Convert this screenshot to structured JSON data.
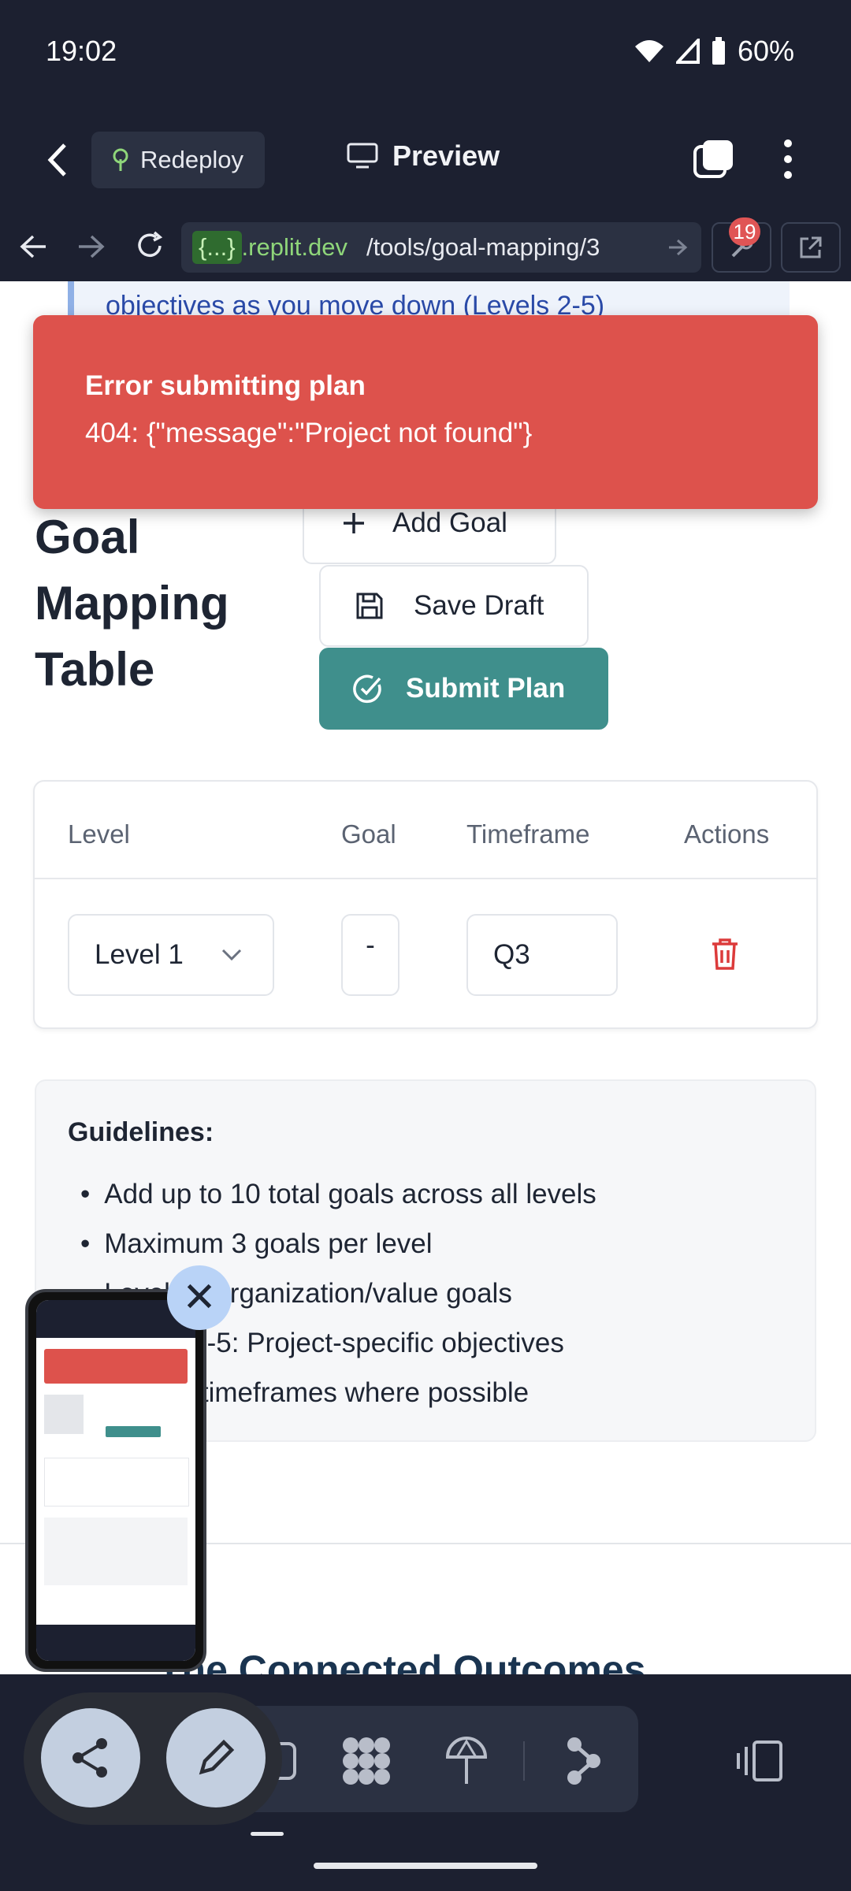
{
  "status_bar": {
    "time": "19:02",
    "battery": "60%"
  },
  "app_bar": {
    "redeploy_label": "Redeploy",
    "preview_label": "Preview"
  },
  "url_bar": {
    "brace": "{...}",
    "domain": ".replit.dev",
    "path": "/tools/goal-mapping/3",
    "badge_count": "19"
  },
  "page": {
    "partial_text_top": "objectives as you move down (Levels 2-5)",
    "toast": {
      "title": "Error submitting plan",
      "message": "404: {\"message\":\"Project not found\"}"
    },
    "heading": "Goal Mapping Table",
    "buttons": {
      "add_goal": "Add Goal",
      "save_draft": "Save Draft",
      "submit_plan": "Submit Plan"
    },
    "table": {
      "headers": [
        "Level",
        "Goal",
        "Timeframe",
        "Actions"
      ],
      "rows": [
        {
          "level": "Level 1",
          "goal": "-",
          "timeframe": "Q3"
        }
      ]
    },
    "guidelines": {
      "title": "Guidelines:",
      "items": [
        "Add up to 10 total goals across all levels",
        "Maximum 3 goals per level",
        "Level 1: Organization/value goals",
        "Levels 2-5: Project-specific objectives",
        "Include timeframes where possible"
      ]
    },
    "section_title": "The Connected Outcomes Framework"
  },
  "colors": {
    "accent": "#3f8f8c",
    "error": "#dd524c",
    "chrome": "#1c2030"
  }
}
